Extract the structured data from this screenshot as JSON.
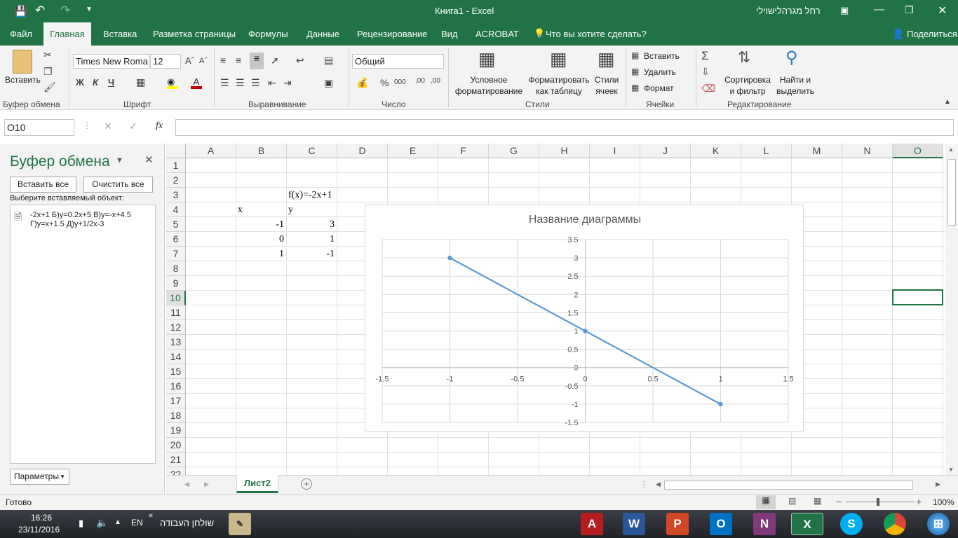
{
  "window": {
    "title": "Книга1  -  Excel",
    "user": "רחל מגרהלישוילי"
  },
  "ribbon_tabs": [
    "Файл",
    "Главная",
    "Вставка",
    "Разметка страницы",
    "Формулы",
    "Данные",
    "Рецензирование",
    "Вид",
    "ACROBAT"
  ],
  "tell_me": "Что вы хотите сделать?",
  "share": "Поделиться",
  "ribbon": {
    "paste": "Вставить",
    "font_name": "Times New Roma",
    "font_size": "12",
    "bold": "Ж",
    "italic": "К",
    "underline": "Ч",
    "number_format": "Общий",
    "cond_fmt": [
      "Условное",
      "форматирование"
    ],
    "fmt_table": [
      "Форматировать",
      "как таблицу"
    ],
    "cell_styles": [
      "Стили",
      "ячеек"
    ],
    "insert": "Вставить",
    "delete": "Удалить",
    "format": "Формат",
    "sort": [
      "Сортировка",
      "и фильтр"
    ],
    "find": [
      "Найти и",
      "выделить"
    ],
    "groups": [
      "Буфер обмена",
      "Шрифт",
      "Выравнивание",
      "Число",
      "Стили",
      "Ячейки",
      "Редактирование"
    ]
  },
  "formula_bar": {
    "name_box": "O10",
    "fx": "fx",
    "formula": ""
  },
  "clipboard": {
    "title": "Буфер обмена",
    "paste_all": "Вставить все",
    "clear_all": "Очистить все",
    "prompt": "Выберите вставляемый объект:",
    "item_line1": "-2x+1 Б)y=0.2x+5 В)y=-x+4.5",
    "item_line2": "Г)y=x+1.5 Д)y+1/2x-3",
    "options": "Параметры"
  },
  "columns": [
    "A",
    "B",
    "C",
    "D",
    "E",
    "F",
    "G",
    "H",
    "I",
    "J",
    "K",
    "L",
    "M",
    "N",
    "O"
  ],
  "rows": [
    "1",
    "2",
    "3",
    "4",
    "5",
    "6",
    "7",
    "8",
    "9",
    "10",
    "11",
    "12",
    "13",
    "14",
    "15",
    "16",
    "17",
    "18",
    "19",
    "20",
    "21",
    "22"
  ],
  "cells": {
    "C3": "f(x)=-2x+1",
    "B4": "x",
    "C4": "y",
    "B5": "-1",
    "C5": "3",
    "B6": "0",
    "C6": "1",
    "B7": "1",
    "C7": "-1"
  },
  "chart_data": {
    "type": "scatter",
    "title": "Название диаграммы",
    "x": [
      -1,
      0,
      1
    ],
    "y": [
      3,
      1,
      -1
    ],
    "xlim": [
      -1.5,
      1.5
    ],
    "ylim": [
      -1.5,
      3.5
    ],
    "x_ticks": [
      "-1.5",
      "-1",
      "-0.5",
      "0",
      "0.5",
      "1",
      "1.5"
    ],
    "y_ticks": [
      "3.5",
      "3",
      "2.5",
      "2",
      "1.5",
      "1",
      "0.5",
      "0",
      "-0.5",
      "-1",
      "-1.5"
    ],
    "grid": true,
    "color": "#5b9bd5"
  },
  "sheet_tabs": [
    "Лист2"
  ],
  "status": {
    "ready": "Готово",
    "zoom": "100%"
  },
  "taskbar": {
    "time": "16:26",
    "date": "23/11/2016",
    "lang": "EN",
    "desktop": "שולחן העבודה"
  },
  "colors": {
    "excel_green": "#217346",
    "accent_series": "#5b9bd5"
  }
}
